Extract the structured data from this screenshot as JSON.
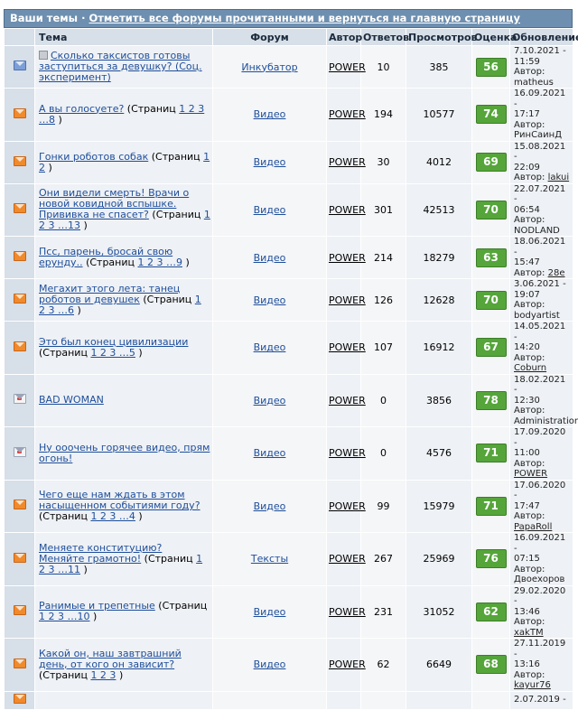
{
  "header": {
    "title": "Ваши темы",
    "separator": "·",
    "mark_all_link": "Отметить все форумы прочитанными и вернуться на главную страницу"
  },
  "columns": {
    "topic": "Тема",
    "forum": "Форум",
    "author": "Автор",
    "replies": "Ответов",
    "views": "Просмотров",
    "rating": "Оценка",
    "updated": "Обновление"
  },
  "labels": {
    "pages_open": "(Страниц",
    "pages_close": ")",
    "author_prefix": "Автор:"
  },
  "icons": {
    "orange_envelope": "envelope-orange-icon",
    "blue_envelope": "envelope-blue-icon",
    "gray_envelope": "envelope-hot-icon",
    "poll": "poll-icon"
  },
  "colors": {
    "header_bar": "#6e8fb0",
    "column_header": "#d7dfe8",
    "rating_badge": "#55a53a",
    "link": "#1e4e9a"
  },
  "rows": [
    {
      "icon": "blue",
      "poll": true,
      "title": "Сколько таксистов готовы заступиться за девушку? (Соц. эксперимент)",
      "pages": "",
      "forum": "Инкубатор",
      "author": "POWER",
      "replies": "10",
      "views": "385",
      "rating": "56",
      "date": "7.10.2021 -",
      "time": "11:59",
      "last_author": "matheus",
      "last_author_link": false
    },
    {
      "icon": "orange",
      "poll": false,
      "title": "А вы голосуете?",
      "pages": "1 2 3 …8",
      "forum": "Видео",
      "author": "POWER",
      "replies": "194",
      "views": "10577",
      "rating": "74",
      "date": "16.09.2021 -",
      "time": "17:17",
      "last_author": "РинСаинД",
      "last_author_link": false
    },
    {
      "icon": "orange",
      "poll": false,
      "title": "Гонки роботов собак",
      "pages": "1 2",
      "forum": "Видео",
      "author": "POWER",
      "replies": "30",
      "views": "4012",
      "rating": "69",
      "date": "15.08.2021 -",
      "time": "22:09",
      "last_author": "lakui",
      "last_author_link": true
    },
    {
      "icon": "orange",
      "poll": false,
      "title": "Они видели смерть! Врачи о новой ковидной вспышке. Прививка не спасет?",
      "pages": "1 2 3 …13",
      "forum": "Видео",
      "author": "POWER",
      "replies": "301",
      "views": "42513",
      "rating": "70",
      "date": "22.07.2021 -",
      "time": "06:54",
      "last_author": "NODLAND",
      "last_author_link": false
    },
    {
      "icon": "orange",
      "poll": false,
      "title": "Псс, парень, бросай свою ерунду..",
      "pages": "1 2 3 …9",
      "forum": "Видео",
      "author": "POWER",
      "replies": "214",
      "views": "18279",
      "rating": "63",
      "date": "18.06.2021 -",
      "time": "15:47",
      "last_author": "28e",
      "last_author_link": true
    },
    {
      "icon": "orange",
      "poll": false,
      "title": "Мегахит этого лета: танец роботов и девушек",
      "pages": "1 2 3 …6",
      "forum": "Видео",
      "author": "POWER",
      "replies": "126",
      "views": "12628",
      "rating": "70",
      "date": "3.06.2021 -",
      "time": "19:07",
      "last_author": "bodyartist",
      "last_author_link": false
    },
    {
      "icon": "orange",
      "poll": false,
      "title": "Это был конец цивилизации",
      "pages": "1 2 3 …5",
      "forum": "Видео",
      "author": "POWER",
      "replies": "107",
      "views": "16912",
      "rating": "67",
      "date": "14.05.2021 -",
      "time": "14:20",
      "last_author": "Coburn",
      "last_author_link": true
    },
    {
      "icon": "gray",
      "poll": false,
      "title": "BAD WOMAN",
      "pages": "",
      "forum": "Видео",
      "author": "POWER",
      "replies": "0",
      "views": "3856",
      "rating": "78",
      "date": "18.02.2021 -",
      "time": "12:30",
      "last_author": "Administration",
      "last_author_link": false
    },
    {
      "icon": "gray",
      "poll": false,
      "title": "Ну ооочень горячее видео, прям огонь!",
      "pages": "",
      "forum": "Видео",
      "author": "POWER",
      "replies": "0",
      "views": "4576",
      "rating": "71",
      "date": "17.09.2020 -",
      "time": "11:00",
      "last_author": "POWER",
      "last_author_link": true
    },
    {
      "icon": "orange",
      "poll": false,
      "title": "Чего еще нам ждать в этом насыщенном событиями году?",
      "pages": "1 2 3 …4",
      "forum": "Видео",
      "author": "POWER",
      "replies": "99",
      "views": "15979",
      "rating": "71",
      "date": "17.06.2020 -",
      "time": "17:47",
      "last_author": "PapaRoll",
      "last_author_link": true
    },
    {
      "icon": "orange",
      "poll": false,
      "title": "Меняете конституцию? Меняйте грамотно!",
      "pages": "1 2 3 …11",
      "forum": "Тексты",
      "author": "POWER",
      "replies": "267",
      "views": "25969",
      "rating": "76",
      "date": "16.09.2021 -",
      "time": "07:15",
      "last_author": "Двоехоров",
      "last_author_link": false
    },
    {
      "icon": "orange",
      "poll": false,
      "title": "Ранимые и трепетные",
      "pages": "1 2 3 …10",
      "forum": "Видео",
      "author": "POWER",
      "replies": "231",
      "views": "31052",
      "rating": "62",
      "date": "29.02.2020 -",
      "time": "13:46",
      "last_author": "xakTM",
      "last_author_link": true
    },
    {
      "icon": "orange",
      "poll": false,
      "title": "Какой он, наш завтрашний день, от кого он зависит?",
      "pages": "1 2 3",
      "forum": "Видео",
      "author": "POWER",
      "replies": "62",
      "views": "6649",
      "rating": "68",
      "date": "27.11.2019 -",
      "time": "13:16",
      "last_author": "kayur76",
      "last_author_link": true
    },
    {
      "icon": "orange",
      "poll": false,
      "title": "",
      "pages": "",
      "forum": "",
      "author": "",
      "replies": "",
      "views": "",
      "rating": "",
      "date": "2.07.2019 -",
      "time": "",
      "last_author": "",
      "last_author_link": false
    }
  ]
}
